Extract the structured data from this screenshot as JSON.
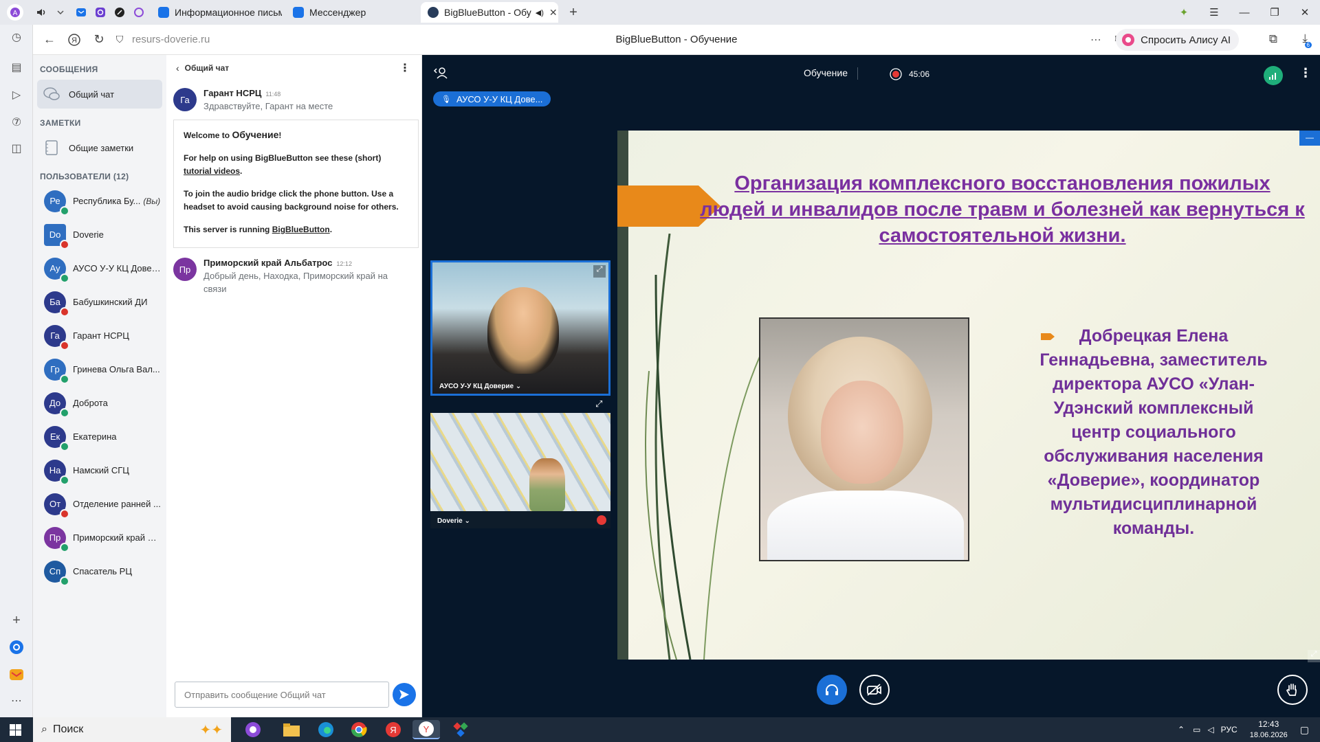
{
  "browser": {
    "tabs": [
      {
        "label": "Информационное письмо",
        "icon": "mail-icon"
      },
      {
        "label": "Мессенджер",
        "icon": "messenger-icon"
      },
      {
        "label": "BigBlueButton - Обу",
        "icon": "bigbluebutton-icon",
        "active": true
      }
    ],
    "url": "resurs-doverie.ru",
    "page_title": "BigBlueButton - Обучение",
    "alice_label": "Спросить Алису AI",
    "downloads_count": "6"
  },
  "sidebar": {
    "messages_header": "СООБЩЕНИЯ",
    "public_chat_label": "Общий чат",
    "notes_header": "ЗАМЕТКИ",
    "shared_notes_label": "Общие заметки",
    "users_header": "ПОЛЬЗОВАТЕЛИ (12)",
    "users": [
      {
        "initials": "Ре",
        "name": "Республика Бу...",
        "you": "(Вы)",
        "color": "#2f6ec0",
        "status": "#22a06b",
        "square": false
      },
      {
        "initials": "Do",
        "name": "Doverie",
        "you": "",
        "color": "#2f6ec0",
        "status": "#d9342b",
        "square": true
      },
      {
        "initials": "Ау",
        "name": "АУСО У-У КЦ Довер...",
        "you": "",
        "color": "#2f6ec0",
        "status": "#22a06b",
        "square": false
      },
      {
        "initials": "Ба",
        "name": "Бабушкинский ДИ",
        "you": "",
        "color": "#2d3a8c",
        "status": "#d9342b",
        "square": false
      },
      {
        "initials": "Га",
        "name": "Гарант НСРЦ",
        "you": "",
        "color": "#2d3a8c",
        "status": "#d9342b",
        "square": false
      },
      {
        "initials": "Гр",
        "name": "Гринева Ольга Вал...",
        "you": "",
        "color": "#2f6ec0",
        "status": "#22a06b",
        "square": false
      },
      {
        "initials": "До",
        "name": "Доброта",
        "you": "",
        "color": "#2d3a8c",
        "status": "#22a06b",
        "square": false
      },
      {
        "initials": "Ек",
        "name": "Екатерина",
        "you": "",
        "color": "#2d3a8c",
        "status": "#22a06b",
        "square": false
      },
      {
        "initials": "На",
        "name": "Намский СГЦ",
        "you": "",
        "color": "#2d3a8c",
        "status": "#22a06b",
        "square": false
      },
      {
        "initials": "От",
        "name": "Отделение ранней ...",
        "you": "",
        "color": "#2d3a8c",
        "status": "#d9342b",
        "square": false
      },
      {
        "initials": "Пр",
        "name": "Приморский край А...",
        "you": "",
        "color": "#7b35a0",
        "status": "#22a06b",
        "square": false
      },
      {
        "initials": "Сп",
        "name": "Спасатель РЦ",
        "you": "",
        "color": "#1f5aa0",
        "status": "#22a06b",
        "square": false
      }
    ]
  },
  "chat": {
    "title": "Общий чат",
    "messages": [
      {
        "initials": "Га",
        "color": "#2d3a8c",
        "name": "Гарант НСРЦ",
        "time": "11:48",
        "text": "Здравствуйте, Гарант на месте"
      },
      {
        "initials": "Пр",
        "color": "#7b35a0",
        "name": "Приморский край Альбатрос",
        "time": "12:12",
        "text": "Добрый день, Находка, Приморский край на связи"
      }
    ],
    "welcome": {
      "line1_prefix": "Welcome to ",
      "line1_meeting": "Обучение",
      "line1_suffix": "!",
      "line2_prefix": "For help on using BigBlueButton see these (short) ",
      "line2_link": "tutorial videos",
      "line2_suffix": ".",
      "line3": "To join the audio bridge click the phone button. Use a headset to avoid causing background noise for others.",
      "line4_prefix": "This server is running ",
      "line4_link": "BigBlueButton",
      "line4_suffix": "."
    },
    "input_placeholder": "Отправить сообщение Общий чат"
  },
  "meeting": {
    "title": "Обучение",
    "recording_time": "45:06",
    "talking_indicator": "АУСО У-У КЦ Дове...",
    "cameras": [
      {
        "label": "АУСО У-У КЦ Доверие ⌄"
      },
      {
        "label": "Doverie ⌄"
      }
    ]
  },
  "slide": {
    "title": "Организация комплексного восстановления пожилых людей и инвалидов после травм и болезней как вернуться к самостоятельной жизни.",
    "body": "Добрецкая Елена Геннадьевна, заместитель директора АУСО «Улан-Удэнский комплексный центр социального обслуживания населения «Доверие», координатор мультидисциплинарной команды."
  },
  "taskbar": {
    "search_label": "Поиск",
    "language": "РУС",
    "time": "12:43",
    "date": "18.06.2026"
  }
}
